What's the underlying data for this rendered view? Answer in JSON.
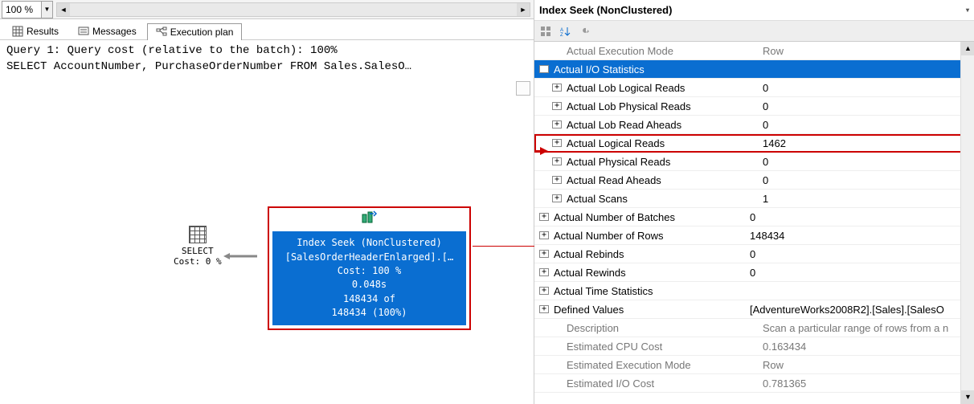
{
  "zoom": {
    "value": "100 %"
  },
  "tabs": {
    "results": "Results",
    "messages": "Messages",
    "execplan": "Execution plan"
  },
  "query": {
    "line1": "Query 1: Query cost (relative to the batch): 100%",
    "line2": "SELECT AccountNumber, PurchaseOrderNumber FROM Sales.SalesO…"
  },
  "plan": {
    "select_label": "SELECT",
    "select_cost": "Cost: 0 %",
    "seek": {
      "title": "Index Seek (NonClustered)",
      "object": "[SalesOrderHeaderEnlarged].[…",
      "cost": "Cost: 100 %",
      "time": "0.048s",
      "rows_of": "148434 of",
      "rows_total": "148434 (100%)"
    }
  },
  "props": {
    "title": "Index Seek (NonClustered)",
    "rows": [
      {
        "indent": 1,
        "exp": "",
        "name": "Actual Execution Mode",
        "val": "Row",
        "gray": true
      },
      {
        "indent": 0,
        "exp": "−",
        "name": "Actual I/O Statistics",
        "val": "",
        "header": true
      },
      {
        "indent": 1,
        "exp": "+",
        "name": "Actual Lob Logical Reads",
        "val": "0"
      },
      {
        "indent": 1,
        "exp": "+",
        "name": "Actual Lob Physical Reads",
        "val": "0"
      },
      {
        "indent": 1,
        "exp": "+",
        "name": "Actual Lob Read Aheads",
        "val": "0"
      },
      {
        "indent": 1,
        "exp": "+",
        "name": "Actual Logical Reads",
        "val": "1462",
        "highlight": true
      },
      {
        "indent": 1,
        "exp": "+",
        "name": "Actual Physical Reads",
        "val": "0"
      },
      {
        "indent": 1,
        "exp": "+",
        "name": "Actual Read Aheads",
        "val": "0"
      },
      {
        "indent": 1,
        "exp": "+",
        "name": "Actual Scans",
        "val": "1"
      },
      {
        "indent": 0,
        "exp": "+",
        "name": "Actual Number of Batches",
        "val": "0"
      },
      {
        "indent": 0,
        "exp": "+",
        "name": "Actual Number of Rows",
        "val": "148434"
      },
      {
        "indent": 0,
        "exp": "+",
        "name": "Actual Rebinds",
        "val": "0"
      },
      {
        "indent": 0,
        "exp": "+",
        "name": "Actual Rewinds",
        "val": "0"
      },
      {
        "indent": 0,
        "exp": "+",
        "name": "Actual Time Statistics",
        "val": ""
      },
      {
        "indent": 0,
        "exp": "+",
        "name": "Defined Values",
        "val": "[AdventureWorks2008R2].[Sales].[SalesO"
      },
      {
        "indent": 1,
        "exp": "",
        "name": "Description",
        "val": "Scan a particular range of rows from a n",
        "gray": true
      },
      {
        "indent": 1,
        "exp": "",
        "name": "Estimated CPU Cost",
        "val": "0.163434",
        "gray": true
      },
      {
        "indent": 1,
        "exp": "",
        "name": "Estimated Execution Mode",
        "val": "Row",
        "gray": true
      },
      {
        "indent": 1,
        "exp": "",
        "name": "Estimated I/O Cost",
        "val": "0.781365",
        "gray": true
      }
    ]
  }
}
